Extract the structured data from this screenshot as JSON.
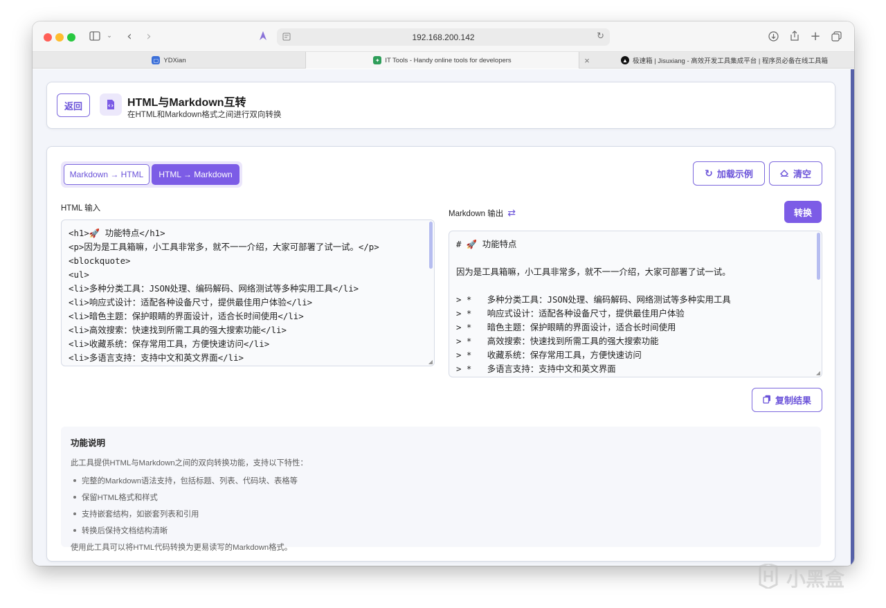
{
  "browser": {
    "url": "192.168.200.142",
    "tabs": [
      {
        "title": "YDXian",
        "icon": "app-icon"
      },
      {
        "title": "IT Tools - Handy online tools for developers",
        "icon": "wrench-icon"
      },
      {
        "title": "极速箱 | Jisuxiang - 高效开发工具集成平台 | 程序员必备在线工具箱",
        "icon": "jisuxiang-logo-icon"
      }
    ],
    "tab_close": "×"
  },
  "header": {
    "back_label": "返回",
    "title": "HTML与Markdown互转",
    "subtitle": "在HTML和Markdown格式之间进行双向转换"
  },
  "mode": {
    "options": [
      "Markdown → HTML",
      "HTML → Markdown"
    ],
    "selected": "HTML → Markdown"
  },
  "actions": {
    "load_example": "加载示例",
    "clear": "清空",
    "convert": "转换",
    "copy_result": "复制结果"
  },
  "input": {
    "label": "HTML 输入",
    "value": "<h1>🚀 功能特点</h1>\n<p>因为是工具箱嘛，小工具非常多，就不一一介绍，大家可部署了试一试。</p>\n<blockquote>\n<ul>\n<li>多种分类工具：JSON处理、编码解码、网络测试等多种实用工具</li>\n<li>响应式设计：适配各种设备尺寸，提供最佳用户体验</li>\n<li>暗色主题：保护眼睛的界面设计，适合长时间使用</li>\n<li>高效搜索：快速找到所需工具的强大搜索功能</li>\n<li>收藏系统：保存常用工具，方便快速访问</li>\n<li>多语言支持：支持中文和英文界面</li>"
  },
  "output": {
    "label": "Markdown 输出",
    "value": "# 🚀 功能特点\n\n因为是工具箱嘛，小工具非常多，就不一一介绍，大家可部署了试一试。\n\n> *   多种分类工具：JSON处理、编码解码、网络测试等多种实用工具\n> *   响应式设计：适配各种设备尺寸，提供最佳用户体验\n> *   暗色主题：保护眼睛的界面设计，适合长时间使用\n> *   高效搜索：快速找到所需工具的强大搜索功能\n> *   收藏系统：保存常用工具，方便快速访问\n> *   多语言支持：支持中文和英文界面"
  },
  "info": {
    "title": "功能说明",
    "intro": "此工具提供HTML与Markdown之间的双向转换功能，支持以下特性：",
    "features": [
      "完整的Markdown语法支持，包括标题、列表、代码块、表格等",
      "保留HTML格式和样式",
      "支持嵌套结构，如嵌套列表和引用",
      "转换后保持文档结构清晰"
    ],
    "footer": "使用此工具可以将HTML代码转换为更易读写的Markdown格式。"
  },
  "watermark": "小黑盒",
  "colors": {
    "accent": "#7c5ce6",
    "accent_text": "#6a52d9",
    "page_bg": "#f3f5fa"
  }
}
